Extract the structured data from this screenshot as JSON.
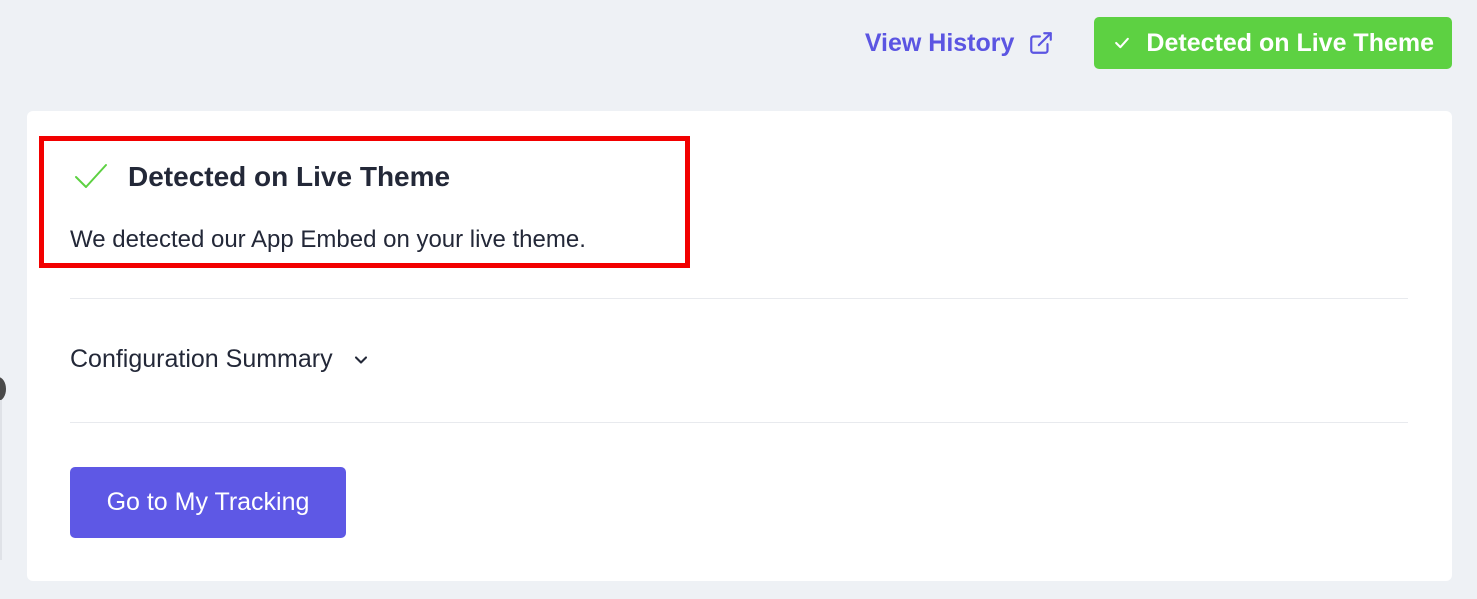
{
  "header": {
    "view_history_label": "View History",
    "view_history_icon": "external-link-icon",
    "status_badge": {
      "label": "Detected on Live Theme",
      "icon": "check-icon",
      "color": "#5dd142"
    }
  },
  "card": {
    "detected": {
      "icon": "check-icon",
      "icon_color": "#5dd142",
      "title": "Detected on Live Theme",
      "description": "We detected our App Embed on your live theme."
    },
    "config_summary": {
      "label": "Configuration Summary",
      "icon": "chevron-down-icon"
    },
    "primary_button": {
      "label": "Go to My Tracking",
      "color": "#5e58e5"
    }
  },
  "colors": {
    "accent": "#5b55e2",
    "highlight": "#f20000",
    "background": "#eef1f5"
  }
}
